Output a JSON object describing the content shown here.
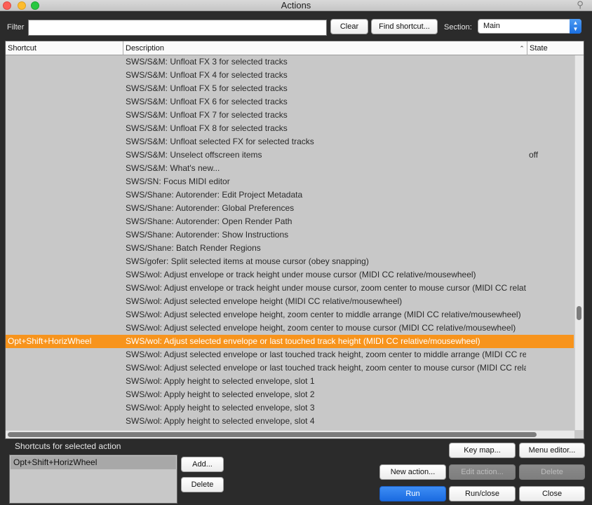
{
  "window": {
    "title": "Actions"
  },
  "filter": {
    "label": "Filter",
    "value": ""
  },
  "buttons": {
    "clear": "Clear",
    "find_shortcut": "Find shortcut...",
    "key_map": "Key map...",
    "menu_editor": "Menu editor...",
    "new_action": "New action...",
    "edit_action": "Edit action...",
    "delete": "Delete",
    "run": "Run",
    "run_close": "Run/close",
    "close": "Close",
    "add": "Add...",
    "delete_shortcut": "Delete"
  },
  "section": {
    "label": "Section:",
    "selected": "Main"
  },
  "table": {
    "columns": {
      "shortcut": "Shortcut",
      "description": "Description",
      "state": "State"
    },
    "sorted_by": "Description",
    "sort_direction": "ascending",
    "rows": [
      {
        "shortcut": "",
        "description": "SWS/S&M: Unfloat FX 3 for selected tracks",
        "state": ""
      },
      {
        "shortcut": "",
        "description": "SWS/S&M: Unfloat FX 4 for selected tracks",
        "state": ""
      },
      {
        "shortcut": "",
        "description": "SWS/S&M: Unfloat FX 5 for selected tracks",
        "state": ""
      },
      {
        "shortcut": "",
        "description": "SWS/S&M: Unfloat FX 6 for selected tracks",
        "state": ""
      },
      {
        "shortcut": "",
        "description": "SWS/S&M: Unfloat FX 7 for selected tracks",
        "state": ""
      },
      {
        "shortcut": "",
        "description": "SWS/S&M: Unfloat FX 8 for selected tracks",
        "state": ""
      },
      {
        "shortcut": "",
        "description": "SWS/S&M: Unfloat selected FX for selected tracks",
        "state": ""
      },
      {
        "shortcut": "",
        "description": "SWS/S&M: Unselect offscreen items",
        "state": "off"
      },
      {
        "shortcut": "",
        "description": "SWS/S&M: What's new...",
        "state": ""
      },
      {
        "shortcut": "",
        "description": "SWS/SN: Focus MIDI editor",
        "state": ""
      },
      {
        "shortcut": "",
        "description": "SWS/Shane: Autorender: Edit Project Metadata",
        "state": ""
      },
      {
        "shortcut": "",
        "description": "SWS/Shane: Autorender: Global Preferences",
        "state": ""
      },
      {
        "shortcut": "",
        "description": "SWS/Shane: Autorender: Open Render Path",
        "state": ""
      },
      {
        "shortcut": "",
        "description": "SWS/Shane: Autorender: Show Instructions",
        "state": ""
      },
      {
        "shortcut": "",
        "description": "SWS/Shane: Batch Render Regions",
        "state": ""
      },
      {
        "shortcut": "",
        "description": "SWS/gofer: Split selected items at mouse cursor (obey snapping)",
        "state": ""
      },
      {
        "shortcut": "",
        "description": "SWS/wol: Adjust envelope or track height under mouse cursor (MIDI CC relative/mousewheel)",
        "state": ""
      },
      {
        "shortcut": "",
        "description": "SWS/wol: Adjust envelope or track height under mouse cursor, zoom center to mouse cursor (MIDI CC relative/mousewheel)",
        "state": ""
      },
      {
        "shortcut": "",
        "description": "SWS/wol: Adjust selected envelope height (MIDI CC relative/mousewheel)",
        "state": ""
      },
      {
        "shortcut": "",
        "description": "SWS/wol: Adjust selected envelope height, zoom center to middle arrange (MIDI CC relative/mousewheel)",
        "state": ""
      },
      {
        "shortcut": "",
        "description": "SWS/wol: Adjust selected envelope height, zoom center to mouse cursor (MIDI CC relative/mousewheel)",
        "state": ""
      },
      {
        "shortcut": "Opt+Shift+HorizWheel",
        "description": "SWS/wol: Adjust selected envelope or last touched track height (MIDI CC relative/mousewheel)",
        "state": "",
        "selected": true
      },
      {
        "shortcut": "",
        "description": "SWS/wol: Adjust selected envelope or last touched track height, zoom center to middle arrange (MIDI CC relative/mousewheel)",
        "state": ""
      },
      {
        "shortcut": "",
        "description": "SWS/wol: Adjust selected envelope or last touched track height, zoom center to mouse cursor (MIDI CC relative/mousewheel)",
        "state": ""
      },
      {
        "shortcut": "",
        "description": "SWS/wol: Apply height to selected envelope, slot 1",
        "state": ""
      },
      {
        "shortcut": "",
        "description": "SWS/wol: Apply height to selected envelope, slot 2",
        "state": ""
      },
      {
        "shortcut": "",
        "description": "SWS/wol: Apply height to selected envelope, slot 3",
        "state": ""
      },
      {
        "shortcut": "",
        "description": "SWS/wol: Apply height to selected envelope, slot 4",
        "state": ""
      }
    ]
  },
  "shortcuts_panel": {
    "label": "Shortcuts for selected action",
    "items": [
      "Opt+Shift+HorizWheel"
    ]
  },
  "colors": {
    "selection": "#f7941d",
    "run_button": "#1b6be0",
    "list_background": "#c8c8c8",
    "window_background": "#2b2b2b"
  }
}
